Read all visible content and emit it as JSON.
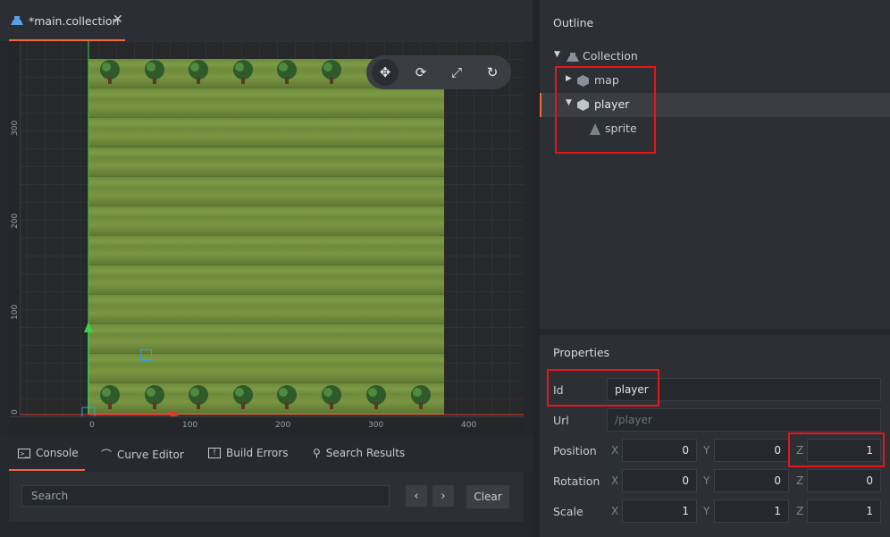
{
  "tab": {
    "title": "*main.collection",
    "close": "✕"
  },
  "viewport": {
    "ruler_y_labels": [
      "0",
      "100",
      "200",
      "300"
    ],
    "ruler_x_labels": [
      "0",
      "100",
      "200",
      "300",
      "400"
    ]
  },
  "toolbar": {
    "tools": [
      "move-tool",
      "rotate-tool",
      "scale-tool",
      "rotate-view-tool"
    ],
    "active": "move-tool"
  },
  "bottom_tabs": [
    {
      "label": "Console",
      "icon": "terminal-icon"
    },
    {
      "label": "Curve Editor",
      "icon": "curve-icon"
    },
    {
      "label": "Build Errors",
      "icon": "error-icon"
    },
    {
      "label": "Search Results",
      "icon": "search-icon"
    }
  ],
  "console": {
    "search_placeholder": "Search",
    "prev": "‹",
    "next": "›",
    "clear_label": "Clear"
  },
  "outline": {
    "title": "Outline",
    "root": "Collection",
    "items": [
      {
        "label": "map",
        "icon": "gameobject-icon",
        "expanded": false
      },
      {
        "label": "player",
        "icon": "gameobject-icon",
        "expanded": true,
        "selected": true
      },
      {
        "label": "sprite",
        "icon": "sprite-icon"
      }
    ]
  },
  "properties": {
    "title": "Properties",
    "id_label": "Id",
    "id_value": "player",
    "url_label": "Url",
    "url_value": "/player",
    "position_label": "Position",
    "position": {
      "x": "0",
      "y": "0",
      "z": "1"
    },
    "rotation_label": "Rotation",
    "rotation": {
      "x": "0",
      "y": "0",
      "z": "0"
    },
    "scale_label": "Scale",
    "scale": {
      "x": "1",
      "y": "1",
      "z": "1"
    },
    "axis_x": "X",
    "axis_y": "Y",
    "axis_z": "Z"
  },
  "colors": {
    "accent": "#f0683b",
    "highlight_box": "#e8141b",
    "grass": "#74913f"
  }
}
